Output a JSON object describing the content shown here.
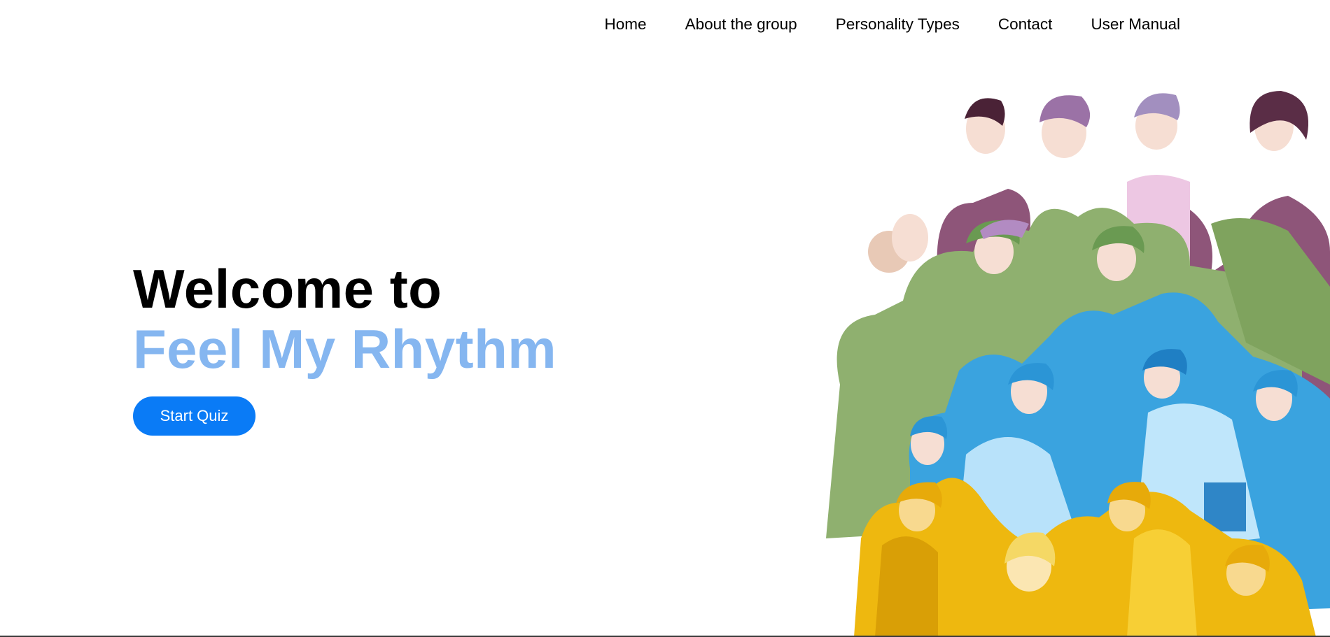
{
  "nav": {
    "items": [
      {
        "label": "Home"
      },
      {
        "label": "About the group"
      },
      {
        "label": "Personality Types"
      },
      {
        "label": "Contact"
      },
      {
        "label": "User Manual"
      }
    ]
  },
  "hero": {
    "line1": "Welcome to",
    "line2": "Feel My Rhythm",
    "cta_label": "Start Quiz"
  },
  "colors": {
    "accent_title": "#85b6f0",
    "button": "#0a7bf6",
    "group_purple": "#8e5579",
    "group_green": "#8fb06f",
    "group_blue": "#3aa3df",
    "group_yellow": "#eeb80f"
  },
  "illustration": {
    "subject": "illustration",
    "groups": [
      "purple",
      "green",
      "blue",
      "yellow"
    ]
  }
}
